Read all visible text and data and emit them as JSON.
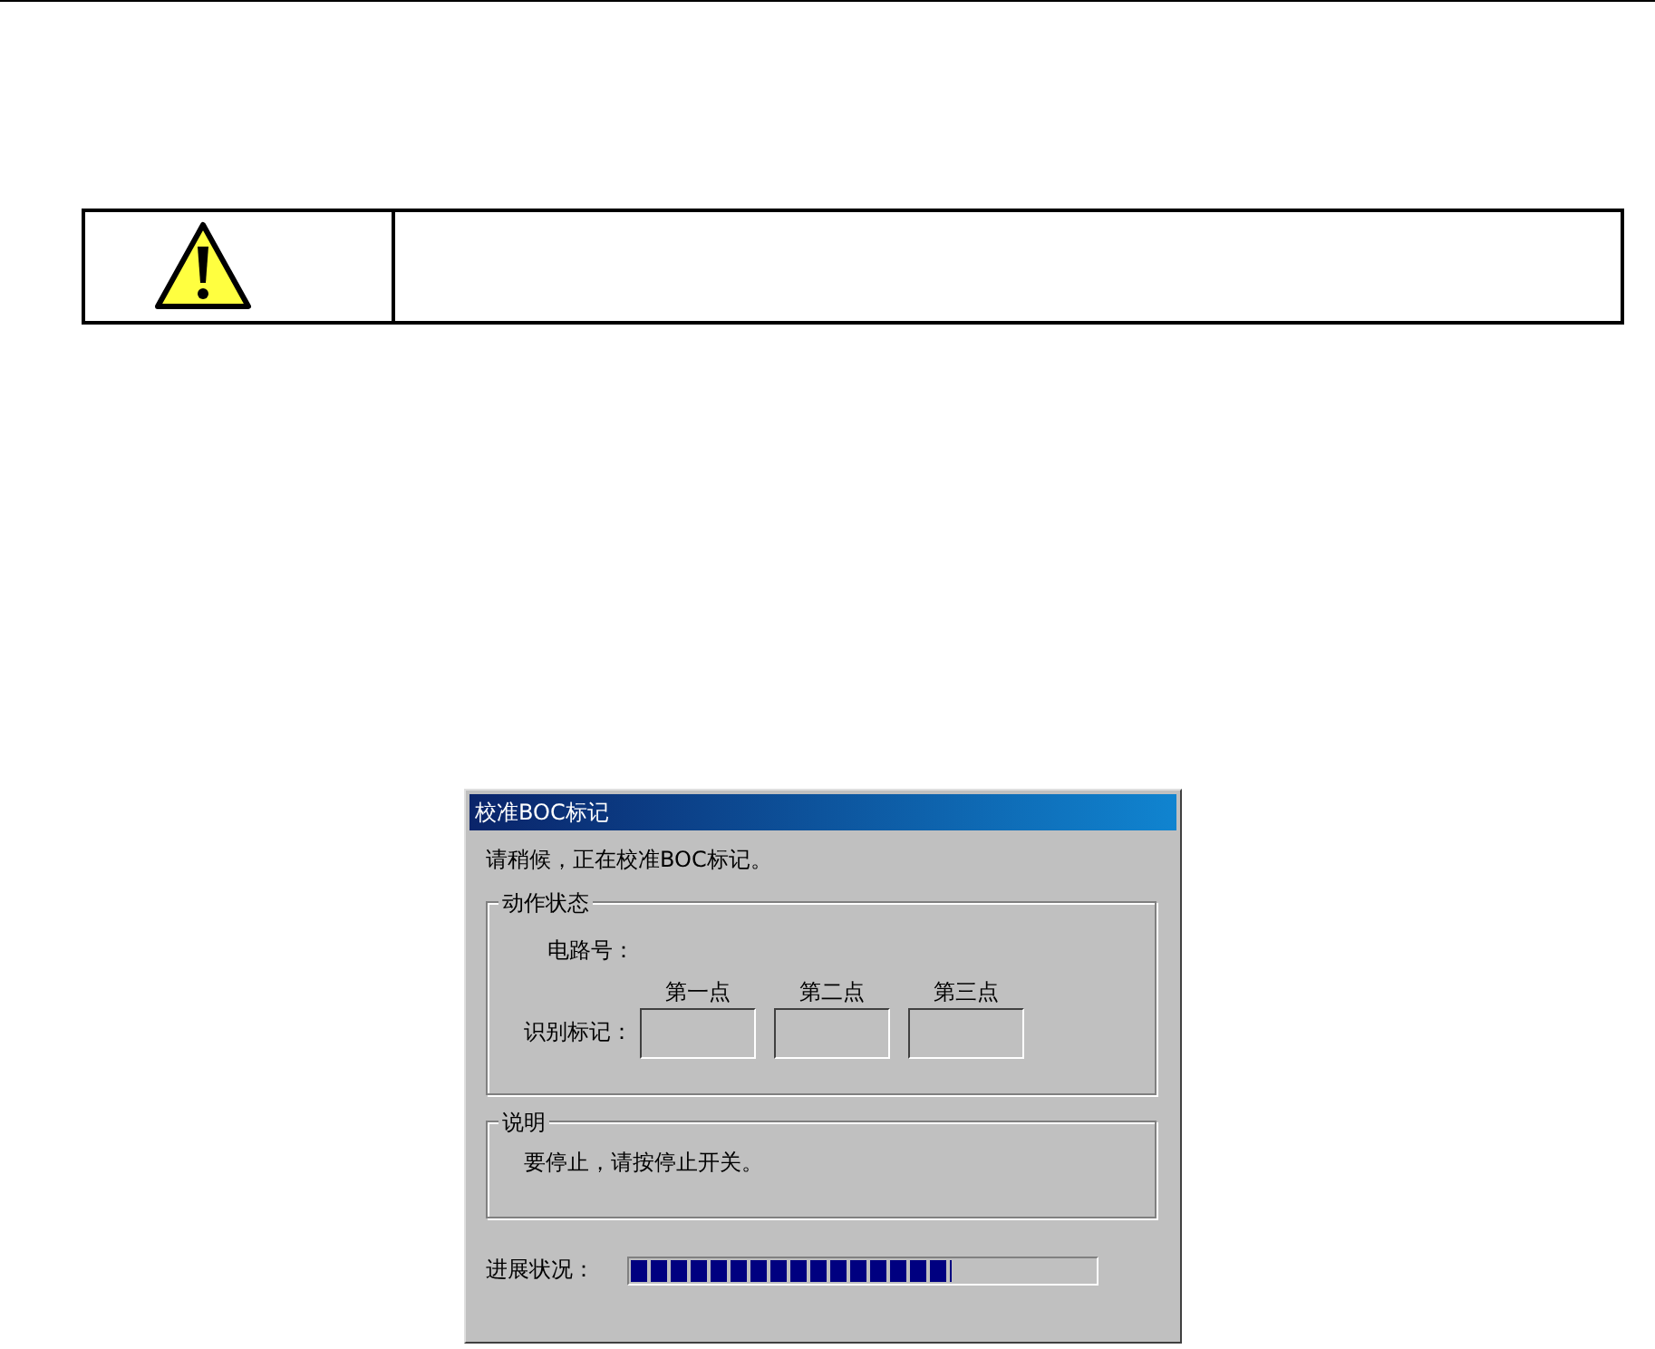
{
  "warning_table": {
    "kind": "warning"
  },
  "dialog": {
    "title": "校准BOC标记",
    "message": "请稍候，正在校准BOC标记。",
    "status_group": {
      "title": "动作状态",
      "circuit_label": "电路号：",
      "mark_label": "识别标记：",
      "points": [
        "第一点",
        "第二点",
        "第三点"
      ]
    },
    "note_group": {
      "title": "说明",
      "text": "要停止，请按停止开关。"
    },
    "progress": {
      "label": "进展状况：",
      "level": 0.69
    }
  }
}
